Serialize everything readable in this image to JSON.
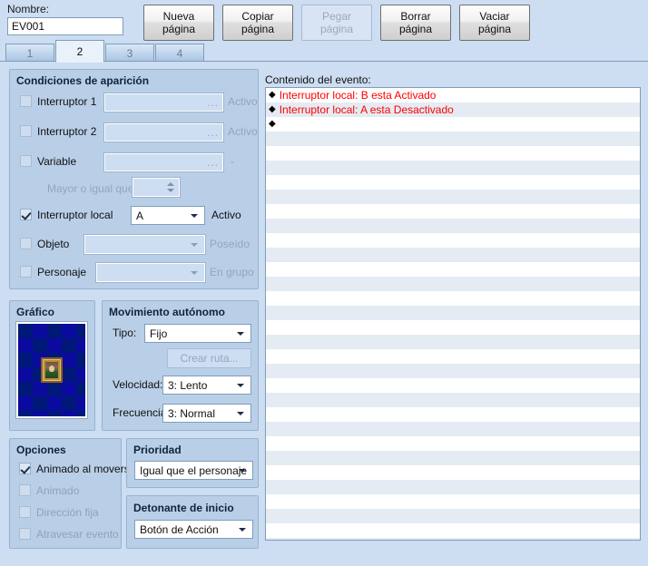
{
  "header": {
    "name_label": "Nombre:",
    "name_value": "EV001",
    "buttons": [
      {
        "label_line1": "Nueva",
        "label_line2": "página",
        "enabled": true,
        "name": "new-page-button"
      },
      {
        "label_line1": "Copiar",
        "label_line2": "página",
        "enabled": true,
        "name": "copy-page-button"
      },
      {
        "label_line1": "Pegar",
        "label_line2": "página",
        "enabled": false,
        "name": "paste-page-button"
      },
      {
        "label_line1": "Borrar",
        "label_line2": "página",
        "enabled": true,
        "name": "delete-page-button"
      },
      {
        "label_line1": "Vaciar",
        "label_line2": "página",
        "enabled": true,
        "name": "clear-page-button"
      }
    ]
  },
  "tabs": [
    {
      "label": "1",
      "selected": false
    },
    {
      "label": "2",
      "selected": true
    },
    {
      "label": "3",
      "selected": false
    },
    {
      "label": "4",
      "selected": false
    }
  ],
  "conditions": {
    "title": "Condiciones de aparición",
    "switch1": {
      "label": "Interruptor 1",
      "checked": false,
      "value": "",
      "ellipsis": "...",
      "state": "Activo"
    },
    "switch2": {
      "label": "Interruptor 2",
      "checked": false,
      "value": "",
      "ellipsis": "...",
      "state": "Activo"
    },
    "variable": {
      "label": "Variable",
      "checked": false,
      "value": "",
      "ellipsis": "...",
      "state": "-"
    },
    "greater_label": "Mayor o igual que",
    "greater_value": "",
    "local_switch": {
      "label": "Interruptor local",
      "checked": true,
      "value": "A",
      "state": "Activo"
    },
    "item": {
      "label": "Objeto",
      "checked": false,
      "value": "",
      "state": "Poseído"
    },
    "actor": {
      "label": "Personaje",
      "checked": false,
      "value": "",
      "state": "En grupo"
    }
  },
  "graphic": {
    "title": "Gráfico"
  },
  "movement": {
    "title": "Movimiento autónomo",
    "type_label": "Tipo:",
    "type_value": "Fijo",
    "route_button": "Crear ruta...",
    "speed_label": "Velocidad:",
    "speed_value": "3: Lento",
    "freq_label": "Frecuencia:",
    "freq_value": "3: Normal"
  },
  "options": {
    "title": "Opciones",
    "items": [
      {
        "label": "Animado al moverse",
        "checked": true
      },
      {
        "label": "Animado",
        "checked": false
      },
      {
        "label": "Dirección fija",
        "checked": false
      },
      {
        "label": "Atravesar evento",
        "checked": false
      }
    ]
  },
  "priority": {
    "title": "Prioridad",
    "value": "Igual que el personaje"
  },
  "trigger": {
    "title": "Detonante de inicio",
    "value": "Botón de Acción"
  },
  "event_content": {
    "label": "Contenido del evento:",
    "bullet": "◆",
    "rows": [
      "Interruptor local: B esta Activado",
      "Interruptor local: A esta Desactivado",
      "",
      "",
      "",
      "",
      "",
      "",
      "",
      "",
      "",
      "",
      "",
      "",
      "",
      "",
      "",
      "",
      "",
      "",
      "",
      "",
      "",
      "",
      "",
      "",
      "",
      "",
      "",
      "",
      "",
      "",
      ""
    ]
  },
  "colors": {
    "background": "#cdddf2",
    "group": "#b9cfe8",
    "event_text": "#ff0000",
    "border": "#7f9db9"
  }
}
